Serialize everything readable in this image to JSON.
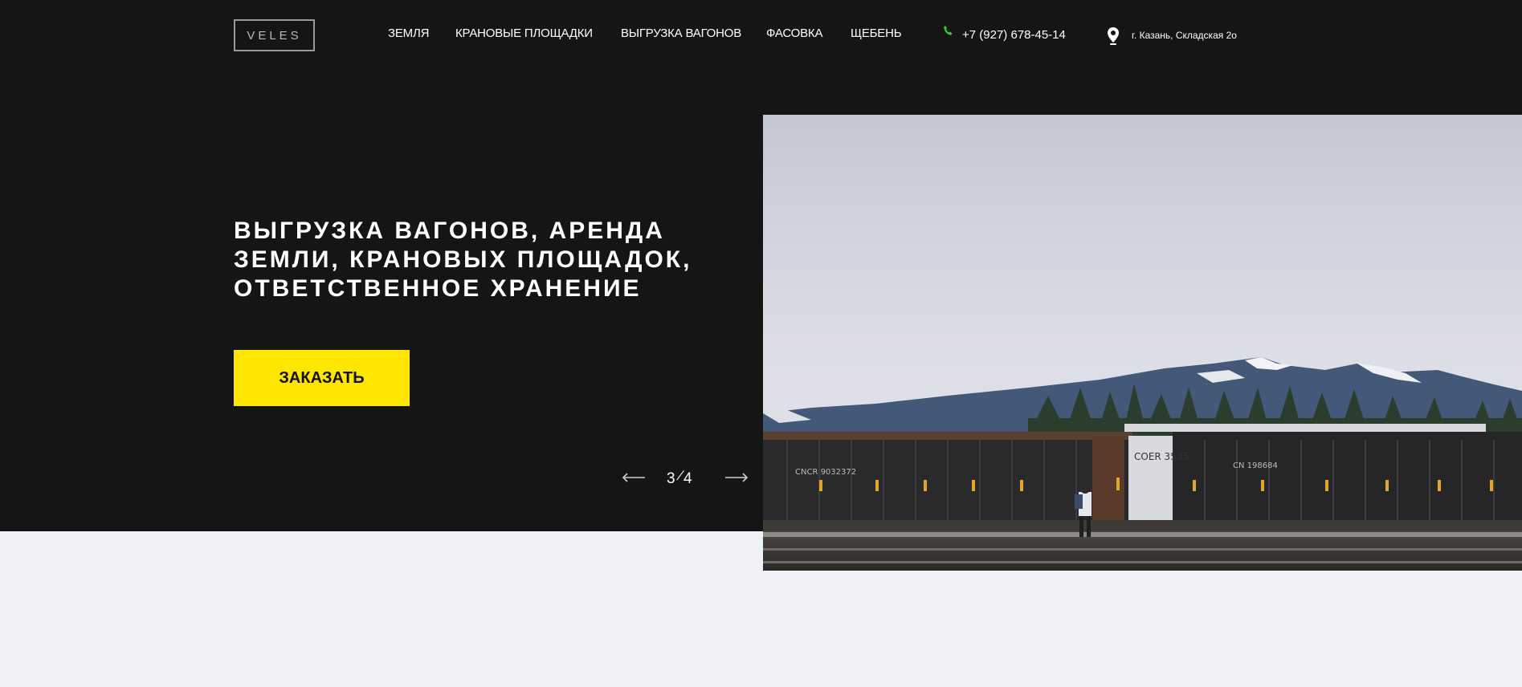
{
  "header": {
    "logo": "VELES",
    "nav": [
      "ЗЕМЛЯ",
      "КРАНОВЫЕ ПЛОЩАДКИ",
      "ВЫГРУЗКА ВАГОНОВ",
      "ФАСОВКА",
      "ЩЕБЕНЬ"
    ],
    "phone": "+7 (927) 678-45-14",
    "address": "г. Казань, Складская 2о"
  },
  "hero": {
    "headline": "ВЫГРУЗКА ВАГОНОВ, АРЕНДА ЗЕМЛИ, КРАНОВЫХ ПЛОЩАДОК, ОТВЕТСТВЕННОЕ ХРАНЕНИЕ",
    "order_button": "ЗАКАЗАТЬ",
    "slider": {
      "current": "3",
      "separator": "/",
      "total": "4"
    },
    "photo": {
      "description_icon": "freight-train-mountains-photo",
      "car_label_left": "CNCR 9032372",
      "car_label_mid": "COER 3535",
      "car_label_right": "CN 198684"
    }
  },
  "colors": {
    "header_bg": "#151515",
    "page_bg": "#f0f1f5",
    "accent_yellow": "#ffe600",
    "phone_icon": "#2fd12f",
    "text_white": "#ffffff"
  },
  "icons": {
    "phone": "phone-icon",
    "location": "map-pin-icon",
    "prev": "arrow-left-icon",
    "next": "arrow-right-icon"
  }
}
